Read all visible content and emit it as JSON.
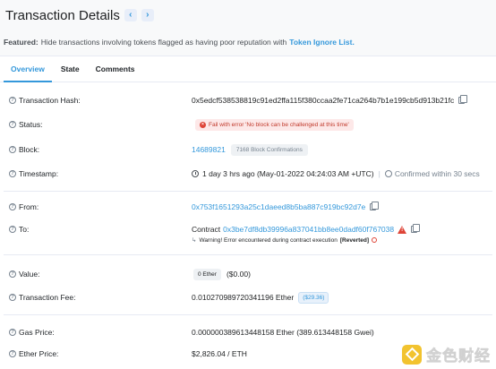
{
  "header": {
    "title": "Transaction Details",
    "prev": "‹",
    "next": "›"
  },
  "featured": {
    "label": "Featured:",
    "text": "Hide transactions involving tokens flagged as having poor reputation with",
    "link": "Token Ignore List."
  },
  "tabs": [
    {
      "label": "Overview"
    },
    {
      "label": "State"
    },
    {
      "label": "Comments"
    }
  ],
  "rows": {
    "tx_hash": {
      "label": "Transaction Hash:",
      "value": "0x5edcf538538819c91ed2ffa115f380ccaa2fe71ca264b7b1e199cb5d913b21fc"
    },
    "status": {
      "label": "Status:",
      "value": "Fail with error 'No block can be challenged at this time'"
    },
    "block": {
      "label": "Block:",
      "value": "14689821",
      "confirmations": "7168 Block Confirmations"
    },
    "timestamp": {
      "label": "Timestamp:",
      "value": "1 day 3 hrs ago (May-01-2022 04:24:03 AM +UTC)",
      "sep": "|",
      "confirmed": "Confirmed within 30 secs"
    },
    "from": {
      "label": "From:",
      "value": "0x753f1651293a25c1daeed8b5ba887c919bc92d7e"
    },
    "to": {
      "label": "To:",
      "prefix": "Contract",
      "value": "0x3be7df8db39996a837041bb8ee0dadf60f767038",
      "warning_arrow": "↳",
      "warning": "Warning! Error encountered during contract execution",
      "reverted": "[Reverted]"
    },
    "value": {
      "label": "Value:",
      "badge": "0 Ether",
      "usd": "($0.00)"
    },
    "fee": {
      "label": "Transaction Fee:",
      "value": "0.010270989720341196 Ether",
      "usd": "($29.36)"
    },
    "gas": {
      "label": "Gas Price:",
      "value": "0.000000389613448158 Ether (389.613448158 Gwei)"
    },
    "ether_price": {
      "label": "Ether Price:",
      "value": "$2,826.04 / ETH"
    }
  },
  "watermark": {
    "text": "金色财经"
  },
  "colors": {
    "accent": "#3498db",
    "error": "#de4437",
    "logo": "#f0b90b"
  }
}
